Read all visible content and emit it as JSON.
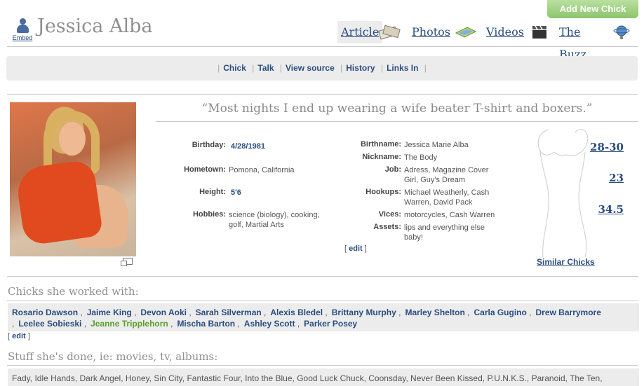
{
  "add_button": "Add New Chick",
  "embed_label": "Embed",
  "title": "Jessica Alba",
  "tabs": [
    {
      "label": "Article",
      "icon": "article-icon"
    },
    {
      "label": "Photos",
      "icon": "photos-icon"
    },
    {
      "label": "Videos",
      "icon": "videos-icon"
    },
    {
      "label": "The Buzz",
      "icon": "buzz-icon"
    }
  ],
  "subnav": [
    "Chick",
    "Talk",
    "View source",
    "History",
    "Links In"
  ],
  "quote": "“Most nights I end up wearing a wife beater T-shirt and boxers.”",
  "left_fields": [
    {
      "label": "Birthday:",
      "value": "4/28/1981",
      "link": true
    },
    {
      "label": "Hometown:",
      "value": "Pomona, California",
      "link": false
    },
    {
      "label": "Height:",
      "value": "5'6",
      "link": true
    },
    {
      "label": "Hobbies:",
      "value": "science (biology), cooking, golf, Martial Arts",
      "link": false
    }
  ],
  "right_fields": [
    {
      "label": "Birthname:",
      "value": "Jessica Marie Alba"
    },
    {
      "label": "Nickname:",
      "value": "The Body"
    },
    {
      "label": "Job:",
      "value": "Adress, Magazine Cover Girl, Guy's Dream"
    },
    {
      "label": "Hookups:",
      "value": "Michael Weatherly, Cash Warren, David Pack"
    },
    {
      "label": "Vices:",
      "value": "motorcycles, Cash Warren"
    },
    {
      "label": "Assets:",
      "value": "lips and everything else baby!"
    }
  ],
  "edit_label": "edit",
  "measurements": [
    "28-30",
    "23",
    "34.5"
  ],
  "similar_label": "Similar Chicks",
  "worked_with_title": "Chicks she worked with:",
  "worked_with": [
    "Rosario Dawson",
    "Jaime King",
    "Devon Aoki",
    "Sarah Silverman",
    "Alexis Bledel",
    "Brittany Murphy",
    "Marley Shelton",
    "Carla Gugino",
    "Drew Barrymore",
    "Leelee Sobieski",
    "Jeanne Tripplehorn",
    "Mischa Barton",
    "Ashley Scott",
    "Parker Posey"
  ],
  "worked_with_highlight": "Jeanne Tripplehorn",
  "stuff_title": "Stuff she's done, ie: movies, tv, albums:",
  "stuff_text": "Fady, Idle Hands, Dark Angel, Honey, Sin City, Fantastic Four, Into the Blue, Good Luck Chuck, Coonsday, Never Been Kissed, P.U.N.K.S., Paranoid, The Ten,",
  "colors": {
    "link": "#2a4d7f",
    "highlight_link": "#5a9e2a",
    "button": "#8cc66c",
    "panel": "#ececec"
  }
}
